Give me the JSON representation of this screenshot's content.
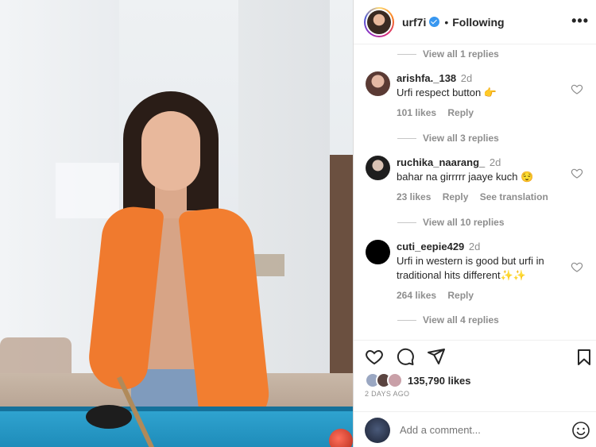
{
  "post": {
    "username": "urf7i",
    "separator": "•",
    "follow_status": "Following",
    "more": "•••"
  },
  "comments": {
    "view_replies_top": "View all 1 replies",
    "items": [
      {
        "username": "arishfa._138",
        "time": "2d",
        "text": "Urfi respect button 👉",
        "likes": "101 likes",
        "reply": "Reply",
        "view_replies": "View all 3 replies",
        "avatar_color": "#7a5a58"
      },
      {
        "username": "ruchika_naarang_",
        "time": "2d",
        "text": "bahar na girrrrr jaaye kuch 😌",
        "likes": "23 likes",
        "reply": "Reply",
        "see_translation": "See translation",
        "view_replies": "View all 10 replies",
        "avatar_color": "#2c2c2c"
      },
      {
        "username": "cuti_eepie429",
        "time": "2d",
        "text": "Urfi in western is good but urfi in traditional hits different✨✨",
        "likes": "264 likes",
        "reply": "Reply",
        "view_replies": "View all 4 replies",
        "avatar_color": "#000000"
      }
    ]
  },
  "actions": {
    "like_icon": "heart-icon",
    "comment_icon": "comment-icon",
    "share_icon": "share-icon",
    "save_icon": "bookmark-icon",
    "likes_count": "135,790 likes",
    "date": "2 DAYS AGO"
  },
  "add_comment": {
    "placeholder": "Add a comment...",
    "emoji_icon": "smiley-icon"
  },
  "colors": {
    "accent_verified": "#3897f0",
    "secondary_text": "#8e8e8e",
    "cardigan": "#f07a2e",
    "pool_table": "#2fa3cf"
  }
}
